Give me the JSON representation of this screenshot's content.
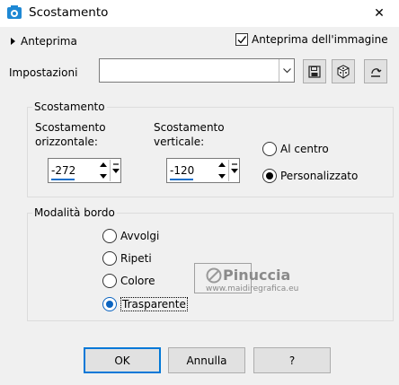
{
  "window": {
    "title": "Scostamento",
    "close_glyph": "✕",
    "app_icon": "camera-icon"
  },
  "top": {
    "preview_label": "Anteprima",
    "image_preview_label": "Anteprima dell'immagine",
    "image_preview_checked": true
  },
  "settings": {
    "label": "Impostazioni",
    "preset_value": "",
    "tool_buttons": [
      "save-icon",
      "randomize-icon",
      "reset-icon"
    ]
  },
  "offset": {
    "group_title": "Scostamento",
    "horizontal_label_line1": "Scostamento",
    "horizontal_label_line2": "orizzontale:",
    "horizontal_value": "-272",
    "vertical_label_line1": "Scostamento",
    "vertical_label_line2": "verticale:",
    "vertical_value": "-120",
    "mode_options": [
      {
        "label": "Al centro",
        "selected": false
      },
      {
        "label": "Personalizzato",
        "selected": true
      }
    ]
  },
  "edge_mode": {
    "group_title": "Modalità bordo",
    "options": [
      {
        "label": "Avvolgi",
        "selected": false
      },
      {
        "label": "Ripeti",
        "selected": false
      },
      {
        "label": "Colore",
        "selected": false
      },
      {
        "label": "Trasparente",
        "selected": true
      }
    ]
  },
  "watermark": {
    "name": "Pinuccia",
    "url": "www.maidiregrafica.eu"
  },
  "buttons": {
    "ok": "OK",
    "cancel": "Annulla",
    "help": "?"
  },
  "colors": {
    "accent": "#0078d7",
    "radio_selected": "#0b64c0"
  }
}
